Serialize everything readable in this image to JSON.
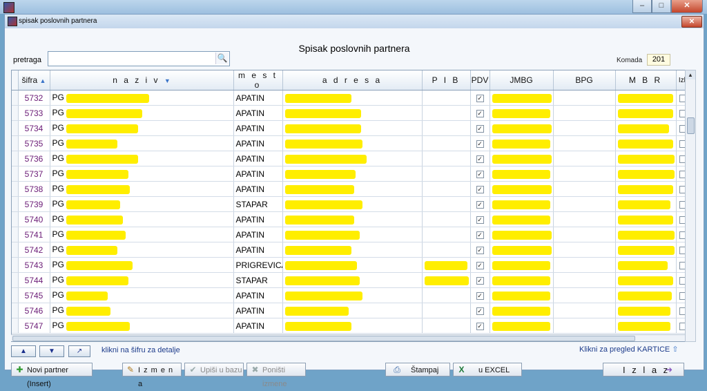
{
  "window": {
    "inner_title": "spisak poslovnih partnera"
  },
  "heading": "Spisak poslovnih partnera",
  "search": {
    "label": "pretraga",
    "value": ""
  },
  "count": {
    "label": "Komada",
    "value": "201"
  },
  "columns": [
    "šifra",
    "n a z i v",
    "m e s t o",
    "a d r e s a",
    "P I B",
    "PDV",
    "JMBG",
    "BPG",
    "M B R",
    "Izb"
  ],
  "rows": [
    {
      "sifra": "5732",
      "naziv": "PG",
      "mesto": "APATIN",
      "pdv": true
    },
    {
      "sifra": "5733",
      "naziv": "PG",
      "mesto": "APATIN",
      "pdv": true
    },
    {
      "sifra": "5734",
      "naziv": "PG",
      "mesto": "APATIN",
      "pdv": true
    },
    {
      "sifra": "5735",
      "naziv": "PG",
      "mesto": "APATIN",
      "pdv": true
    },
    {
      "sifra": "5736",
      "naziv": "PG",
      "mesto": "APATIN",
      "pdv": true
    },
    {
      "sifra": "5737",
      "naziv": "PG",
      "mesto": "APATIN",
      "pdv": true
    },
    {
      "sifra": "5738",
      "naziv": "PG",
      "mesto": "APATIN",
      "pdv": true
    },
    {
      "sifra": "5739",
      "naziv": "PG",
      "mesto": "STAPAR",
      "pdv": true
    },
    {
      "sifra": "5740",
      "naziv": "PG",
      "mesto": "APATIN",
      "pdv": true
    },
    {
      "sifra": "5741",
      "naziv": "PG",
      "mesto": "APATIN",
      "pdv": true
    },
    {
      "sifra": "5742",
      "naziv": "PG",
      "mesto": "APATIN",
      "pdv": true
    },
    {
      "sifra": "5743",
      "naziv": "PG",
      "mesto": "PRIGREVICA",
      "pdv": true
    },
    {
      "sifra": "5744",
      "naziv": "PG",
      "mesto": "STAPAR",
      "pdv": true
    },
    {
      "sifra": "5745",
      "naziv": "PG",
      "mesto": "APATIN",
      "pdv": true
    },
    {
      "sifra": "5746",
      "naziv": "PG",
      "mesto": "APATIN",
      "pdv": true
    },
    {
      "sifra": "5747",
      "naziv": "PG",
      "mesto": "APATIN",
      "pdv": true
    }
  ],
  "links": {
    "details": "klikni na šifru za detalje",
    "kartice_prefix": "Klikni za pregled",
    "kartice": "KARTICE"
  },
  "buttons": {
    "new_partner": "Novi partner (Insert)",
    "edit": "I z m e n a",
    "save": "Upiši u bazu",
    "cancel": "Poništi izmene",
    "print": "Štampaj",
    "excel": "u EXCEL",
    "exit": "I z l a z"
  },
  "colors": {
    "redaction": "#ffee00",
    "code_text": "#6a1b76",
    "link": "#1b3a8a"
  }
}
